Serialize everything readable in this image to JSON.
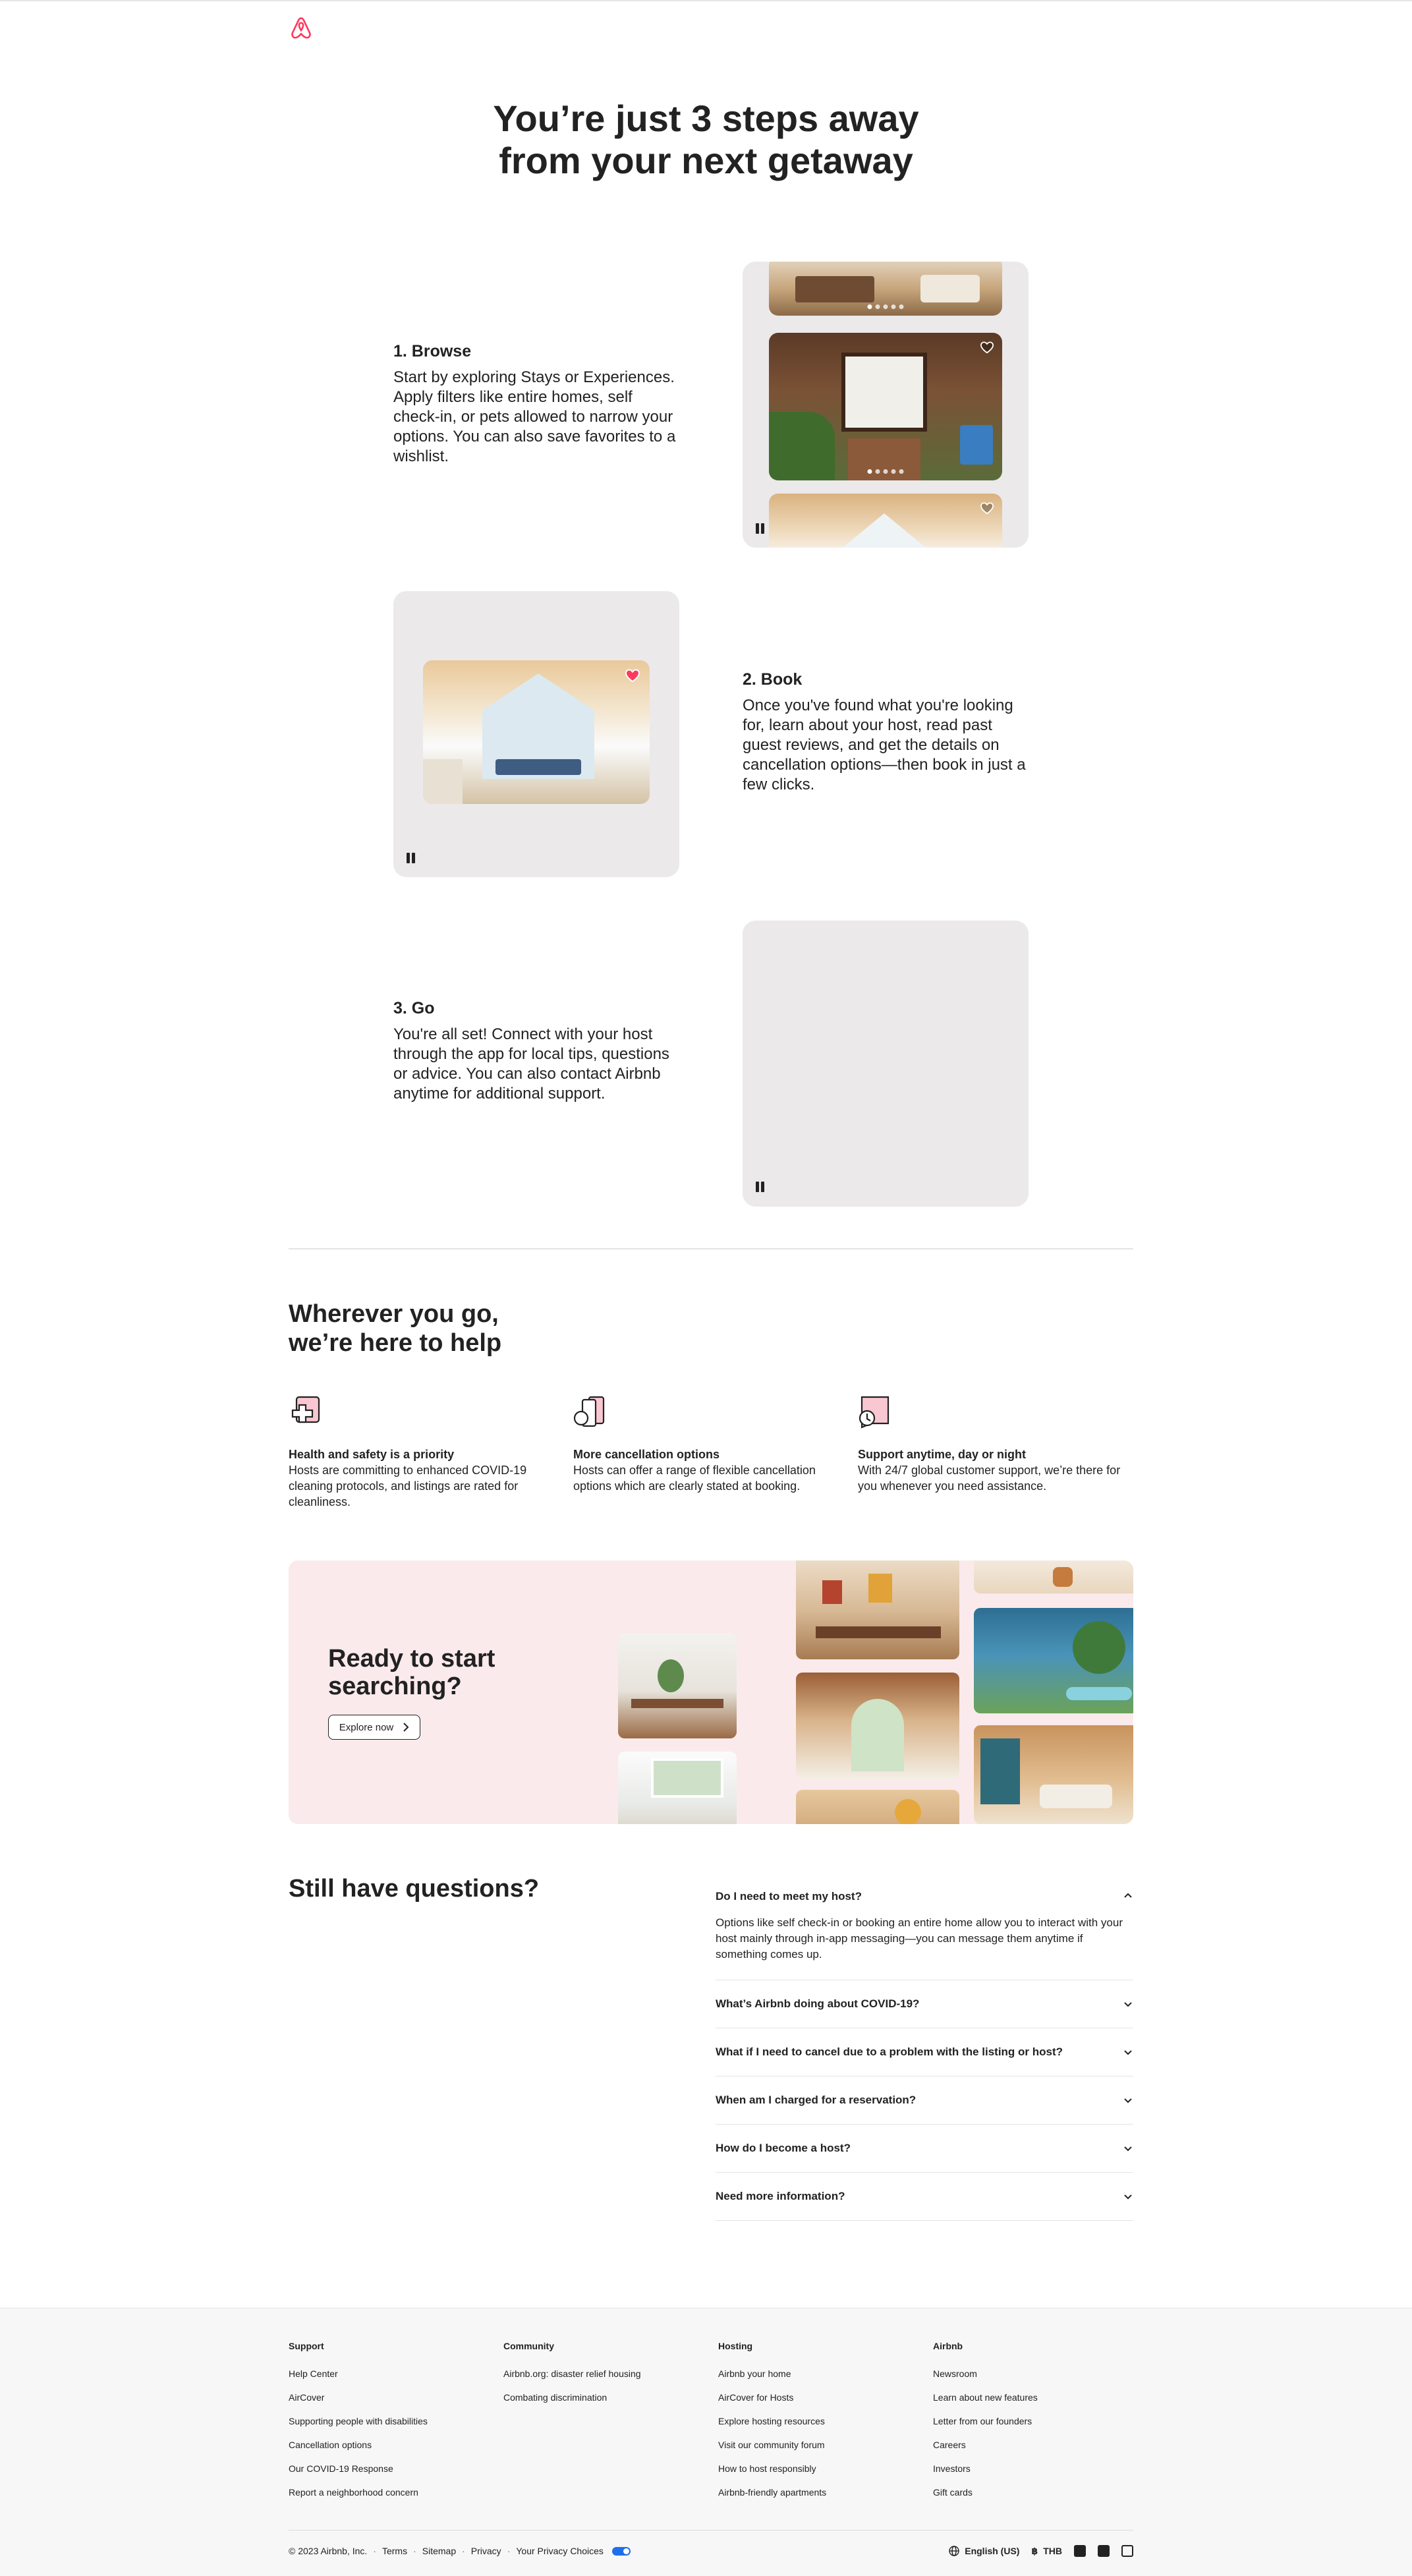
{
  "colors": {
    "brand": "#FF385C",
    "panel": "#EBE9EA",
    "cta_bg": "#FBEAEC",
    "footer_bg": "#F7F7F7"
  },
  "header": {
    "logo_icon": "airbnb-logo-icon"
  },
  "hero": {
    "line1": "You’re just 3 steps away",
    "line2": "from your next getaway"
  },
  "steps": [
    {
      "title": "1. Browse",
      "desc": "Start by exploring Stays or Experiences. Apply filters like entire homes, self check-in, or pets allowed to narrow your options. You can also save favorites to a wishlist."
    },
    {
      "title": "2. Book",
      "desc": "Once you've found what you're looking for, learn about your host, read past guest reviews, and get the details on cancellation options—then book in just a few clicks."
    },
    {
      "title": "3. Go",
      "desc": "You're all set! Connect with your host through the app for local tips, questions or advice. You can also contact Airbnb anytime for additional support."
    }
  ],
  "help": {
    "line1": "Wherever you go,",
    "line2": "we’re here to help",
    "features": [
      {
        "icon": "health-safety-icon",
        "title": "Health and safety is a priority",
        "desc": "Hosts are committing to enhanced COVID-19 cleaning protocols, and listings are rated for cleanliness."
      },
      {
        "icon": "cancellation-icon",
        "title": "More cancellation options",
        "desc": "Hosts can offer a range of flexible cancellation options which are clearly stated at booking."
      },
      {
        "icon": "support-clock-icon",
        "title": "Support anytime, day or night",
        "desc": "With 24/7 global customer support, we’re there for you whenever you need assistance."
      }
    ]
  },
  "cta": {
    "line1": "Ready to start",
    "line2": "searching?",
    "button": "Explore now"
  },
  "questions": {
    "title": "Still have questions?",
    "items": [
      {
        "q": "Do I need to meet my host?",
        "a": "Options like self check-in or booking an entire home allow you to interact with your host mainly through in-app messaging—you can message them anytime if something comes up.",
        "open": true
      },
      {
        "q": "What’s Airbnb doing about COVID-19?"
      },
      {
        "q": "What if I need to cancel due to a problem with the listing or host?"
      },
      {
        "q": "When am I charged for a reservation?"
      },
      {
        "q": "How do I become a host?"
      },
      {
        "q": "Need more information?"
      }
    ]
  },
  "footer": {
    "columns": [
      {
        "title": "Support",
        "links": [
          "Help Center",
          "AirCover",
          "Supporting people with disabilities",
          "Cancellation options",
          "Our COVID-19 Response",
          "Report a neighborhood concern"
        ]
      },
      {
        "title": "Community",
        "links": [
          "Airbnb.org: disaster relief housing",
          "Combating discrimination"
        ]
      },
      {
        "title": "Hosting",
        "links": [
          "Airbnb your home",
          "AirCover for Hosts",
          "Explore hosting resources",
          "Visit our community forum",
          "How to host responsibly",
          "Airbnb-friendly apartments"
        ]
      },
      {
        "title": "Airbnb",
        "links": [
          "Newsroom",
          "Learn about new features",
          "Letter from our founders",
          "Careers",
          "Investors",
          "Gift cards"
        ]
      }
    ],
    "copyright": "© 2023 Airbnb, Inc.",
    "legal": [
      "Terms",
      "Sitemap",
      "Privacy",
      "Your Privacy Choices"
    ],
    "language": "English (US)",
    "currency_symbol": "฿",
    "currency": "THB",
    "social_icons": [
      "facebook-icon",
      "twitter-icon",
      "instagram-icon"
    ]
  }
}
